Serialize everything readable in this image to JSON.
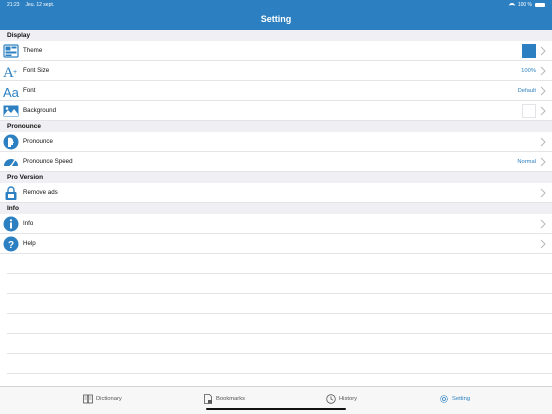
{
  "status_bar": {
    "time": "21:23",
    "date": "Jeu. 12 sept.",
    "battery": "100 %"
  },
  "header": {
    "title": "Setting"
  },
  "sections": [
    {
      "title": "Display",
      "rows": [
        {
          "label": "Theme",
          "value": "",
          "icon": "theme-icon"
        },
        {
          "label": "Font Size",
          "value": "100%",
          "icon": "font-size-icon"
        },
        {
          "label": "Font",
          "value": "Default",
          "icon": "font-icon"
        },
        {
          "label": "Background",
          "value": "",
          "icon": "background-icon"
        }
      ]
    },
    {
      "title": "Pronounce",
      "rows": [
        {
          "label": "Pronounce",
          "value": "",
          "icon": "pronounce-icon"
        },
        {
          "label": "Pronounce Speed",
          "value": "Normal",
          "icon": "speedometer-icon"
        }
      ]
    },
    {
      "title": "Pro Version",
      "rows": [
        {
          "label": "Remove ads",
          "value": "",
          "icon": "remove-ads-icon"
        }
      ]
    },
    {
      "title": "Info",
      "rows": [
        {
          "label": "Info",
          "value": "",
          "icon": "info-icon"
        },
        {
          "label": "Help",
          "value": "",
          "icon": "help-icon"
        }
      ]
    }
  ],
  "tabs": [
    {
      "label": "Dictionary",
      "icon": "book-icon"
    },
    {
      "label": "Bookmarks",
      "icon": "bookmark-icon"
    },
    {
      "label": "History",
      "icon": "clock-icon"
    },
    {
      "label": "Setting",
      "icon": "gear-icon"
    }
  ],
  "colors": {
    "accent": "#2c80c2",
    "section_bg": "#efeff4"
  }
}
